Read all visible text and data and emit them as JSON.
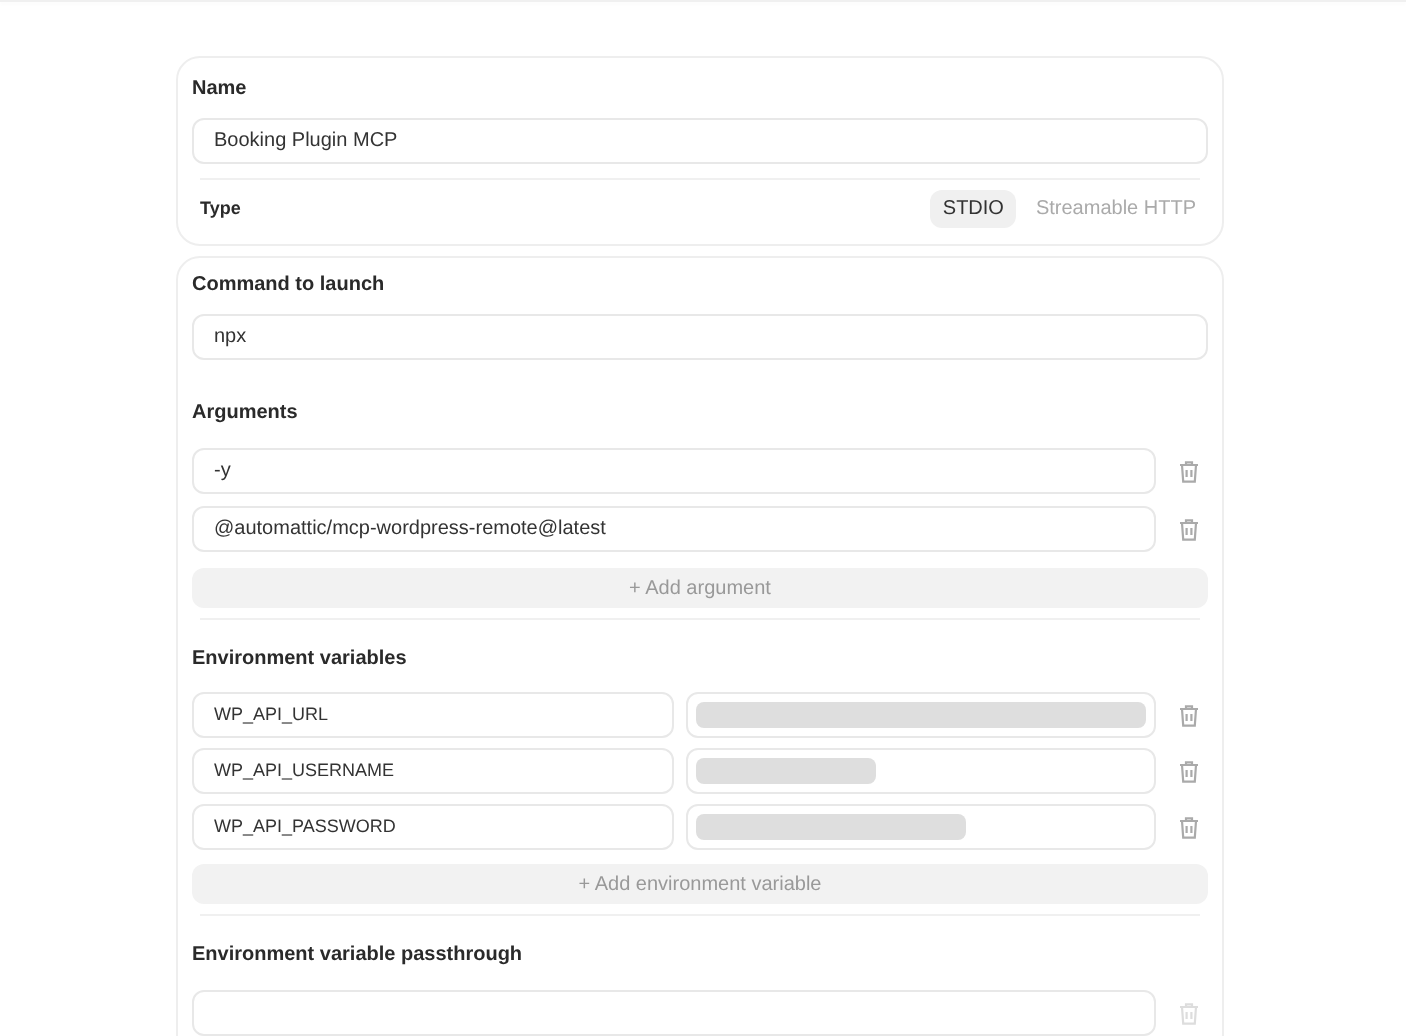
{
  "name": {
    "label": "Name",
    "value": "Booking Plugin MCP"
  },
  "type": {
    "label": "Type",
    "options": [
      {
        "label": "STDIO",
        "selected": true
      },
      {
        "label": "Streamable HTTP",
        "selected": false
      }
    ]
  },
  "command": {
    "label": "Command to launch",
    "value": "npx"
  },
  "arguments": {
    "label": "Arguments",
    "items": [
      {
        "value": "-y"
      },
      {
        "value": "@automattic/mcp-wordpress-remote@latest"
      }
    ],
    "add_button": "+ Add argument"
  },
  "environment": {
    "label": "Environment variables",
    "items": [
      {
        "key": "WP_API_URL",
        "kind": "redacted"
      },
      {
        "key": "WP_API_USERNAME",
        "kind": "redacted"
      },
      {
        "key": "WP_API_PASSWORD",
        "kind": "redacted"
      }
    ],
    "add_button": "+ Add environment variable"
  },
  "passthrough": {
    "label": "Environment variable passthrough",
    "items": [
      {
        "delete_disabled": true
      }
    ]
  }
}
